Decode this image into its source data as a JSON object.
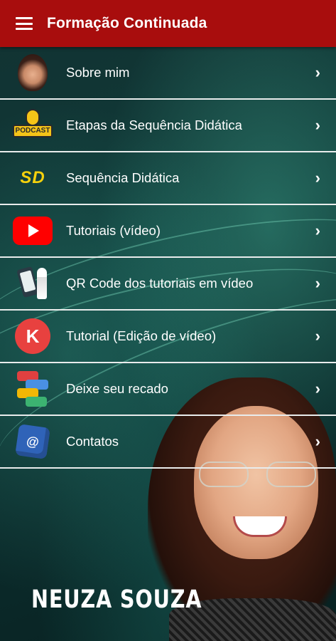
{
  "app_bar": {
    "title": "Formação Continuada",
    "menu_icon": "hamburger-menu-icon",
    "background_color": "#a80d0d"
  },
  "menu": {
    "items": [
      {
        "label": "Sobre mim",
        "icon": "profile-photo-icon"
      },
      {
        "label": "Etapas da Sequência Didática",
        "icon": "podcast-icon",
        "icon_text": "PODCAST"
      },
      {
        "label": "Sequência Didática",
        "icon": "sd-icon",
        "icon_text": "SD"
      },
      {
        "label": "Tutoriais (vídeo)",
        "icon": "youtube-icon"
      },
      {
        "label": "QR Code dos tutoriais em vídeo",
        "icon": "qr-phone-icon"
      },
      {
        "label": "Tutorial (Edição de vídeo)",
        "icon": "kinemaster-icon",
        "icon_text": "K"
      },
      {
        "label": "Deixe seu recado",
        "icon": "chat-bubbles-icon"
      },
      {
        "label": "Contatos",
        "icon": "contacts-cube-icon",
        "icon_text": "@"
      }
    ],
    "chevron": "›"
  },
  "banner": {
    "name": "NEUZA SOUZA"
  }
}
